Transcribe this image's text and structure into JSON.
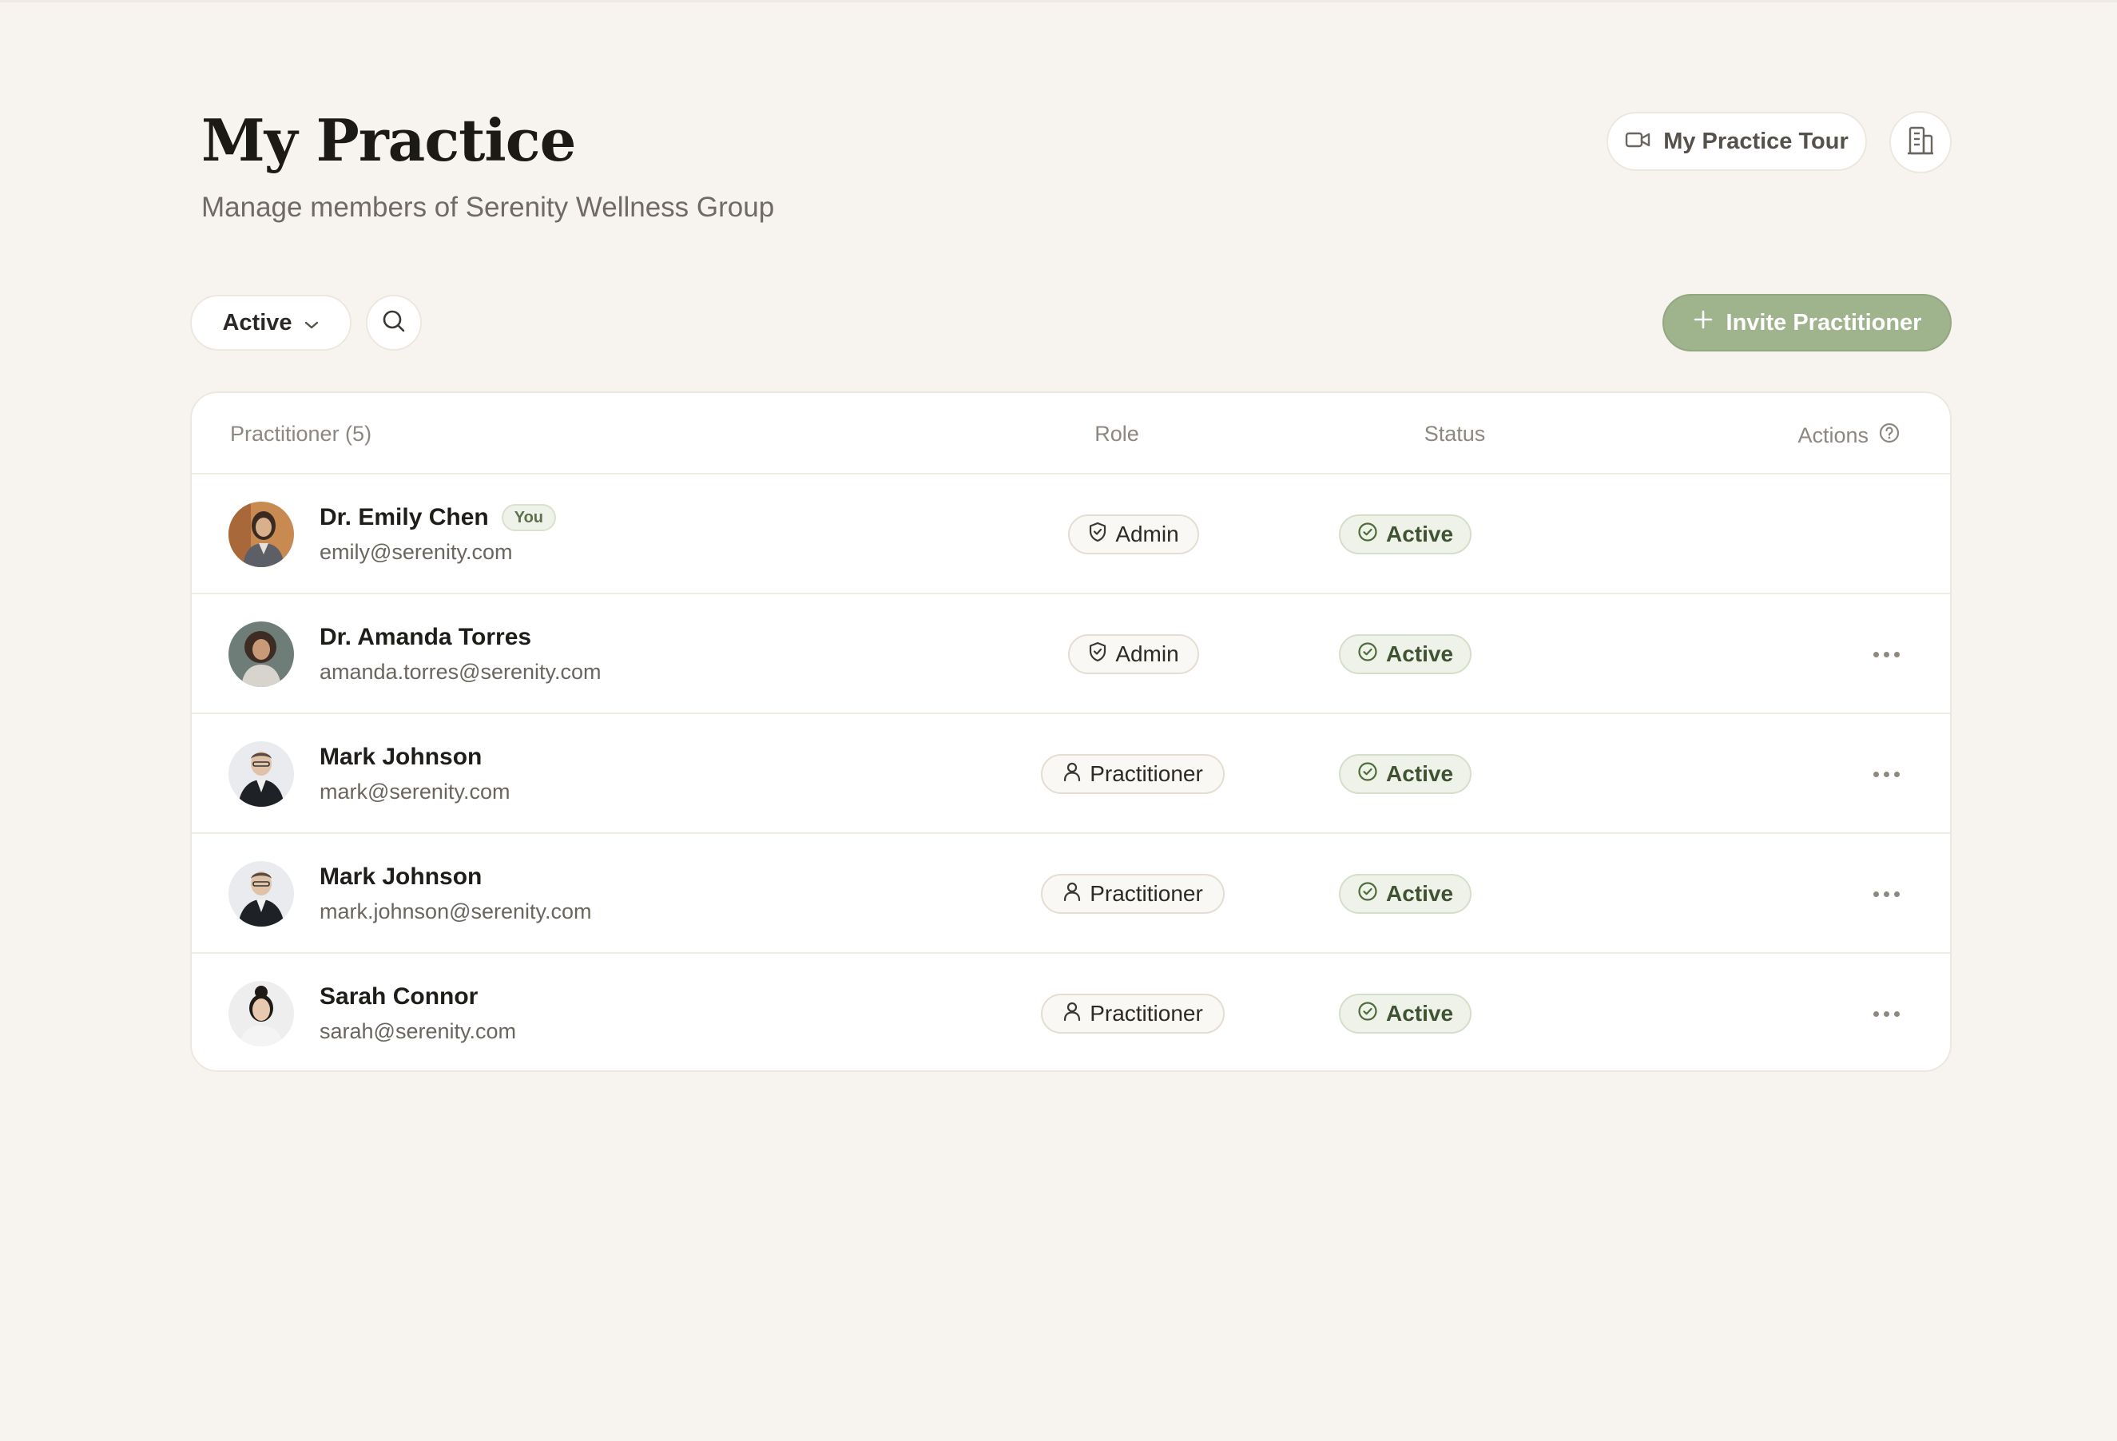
{
  "header": {
    "title": "My Practice",
    "subtitle": "Manage members of Serenity Wellness Group",
    "tour_label": "My Practice Tour"
  },
  "toolbar": {
    "filter_value": "Active",
    "invite_label": "Invite Practitioner"
  },
  "table": {
    "columns": {
      "practitioner": "Practitioner (5)",
      "role": "Role",
      "status": "Status",
      "actions": "Actions"
    },
    "rows": [
      {
        "name": "Dr. Emily Chen",
        "badge": "You",
        "email": "emily@serenity.com",
        "role": "Admin",
        "status": "Active"
      },
      {
        "name": "Dr. Amanda Torres",
        "email": "amanda.torres@serenity.com",
        "role": "Admin",
        "status": "Active"
      },
      {
        "name": "Mark Johnson",
        "email": "mark@serenity.com",
        "role": "Practitioner",
        "status": "Active"
      },
      {
        "name": "Mark Johnson",
        "email": "mark.johnson@serenity.com",
        "role": "Practitioner",
        "status": "Active"
      },
      {
        "name": "Sarah Connor",
        "email": "sarah@serenity.com",
        "role": "Practitioner",
        "status": "Active"
      }
    ]
  },
  "icons": {
    "tour": "video-camera-icon",
    "org": "building-icon",
    "filter_chevron": "chevron-down-icon",
    "search": "search-icon",
    "invite": "plus-icon",
    "actions_help": "help-circle-icon",
    "admin_role": "shield-icon",
    "practitioner_role": "user-icon",
    "status": "check-circle-icon",
    "row_menu": "more-horizontal-icon"
  },
  "colors": {
    "background": "#f7f4ef",
    "accent": "#9fb38c",
    "status_text": "#3f5232"
  }
}
